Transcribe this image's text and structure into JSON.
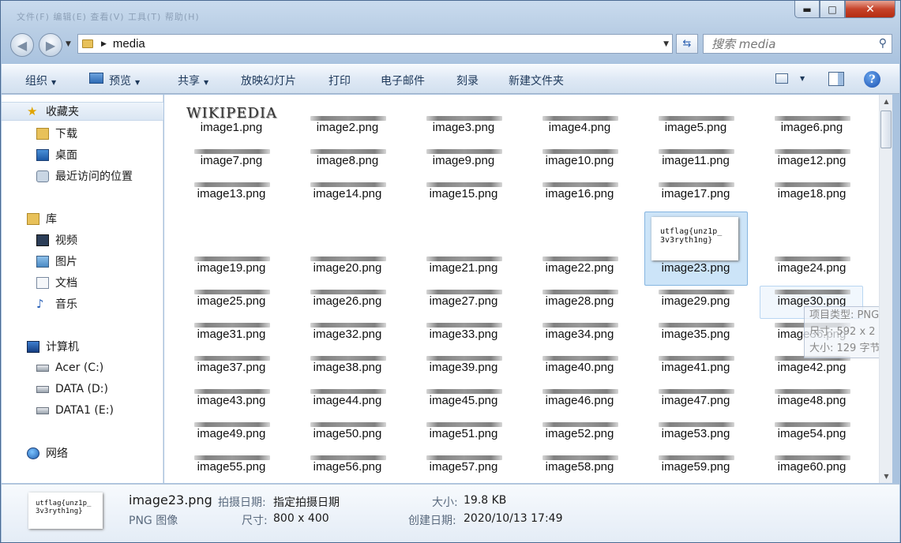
{
  "window": {
    "menu_ghost": "文件(F)  编辑(E)  查看(V)  工具(T)  帮助(H)",
    "min_label": "▬",
    "max_label": "□",
    "close_label": "✕"
  },
  "address": {
    "crumb": "media",
    "search_placeholder": "搜索 media"
  },
  "toolbar": {
    "organize": "组织",
    "preview": "预览",
    "share": "共享",
    "slideshow": "放映幻灯片",
    "print": "打印",
    "email": "电子邮件",
    "burn": "刻录",
    "new_folder": "新建文件夹",
    "help": "?"
  },
  "navpane": {
    "favorites": "收藏夹",
    "downloads": "下载",
    "desktop": "桌面",
    "recent": "最近访问的位置",
    "libraries": "库",
    "videos": "视频",
    "pictures": "图片",
    "documents": "文档",
    "music": "音乐",
    "computer": "计算机",
    "drive_c": "Acer (C:)",
    "drive_d": "DATA (D:)",
    "drive_e": "DATA1 (E:)",
    "network": "网络"
  },
  "files": {
    "wiki_logo": "WIKIPEDIA",
    "names": [
      "image1.png",
      "image2.png",
      "image3.png",
      "image4.png",
      "image5.png",
      "image6.png",
      "image7.png",
      "image8.png",
      "image9.png",
      "image10.png",
      "image11.png",
      "image12.png",
      "image13.png",
      "image14.png",
      "image15.png",
      "image16.png",
      "image17.png",
      "image18.png",
      "image19.png",
      "image20.png",
      "image21.png",
      "image22.png",
      "image23.png",
      "image24.png",
      "image25.png",
      "image26.png",
      "image27.png",
      "image28.png",
      "image29.png",
      "image30.png",
      "image31.png",
      "image32.png",
      "image33.png",
      "image34.png",
      "image35.png",
      "image36.png",
      "image37.png",
      "image38.png",
      "image39.png",
      "image40.png",
      "image41.png",
      "image42.png",
      "image43.png",
      "image44.png",
      "image45.png",
      "image46.png",
      "image47.png",
      "image48.png",
      "image49.png",
      "image50.png",
      "image51.png",
      "image52.png",
      "image53.png",
      "image54.png",
      "image55.png",
      "image56.png",
      "image57.png",
      "image58.png",
      "image59.png",
      "image60.png"
    ],
    "selected_thumb_line1": "utflag{unz1p_",
    "selected_thumb_line2": "3v3ryth1ng}"
  },
  "tooltip": {
    "type": "项目类型: PNG 图",
    "dims": "尺寸: 592 x 2",
    "size": "大小: 129 字节"
  },
  "details": {
    "thumb_line1": "utflag{unz1p_",
    "thumb_line2": "3v3ryth1ng}",
    "filename": "image23.png",
    "filetype": "PNG 图像",
    "date_taken_key": "拍摄日期:",
    "date_taken_val": "指定拍摄日期",
    "dims_key": "尺寸:",
    "dims_val": "800 x 400",
    "size_key": "大小:",
    "size_val": "19.8 KB",
    "created_key": "创建日期:",
    "created_val": "2020/10/13 17:49"
  }
}
